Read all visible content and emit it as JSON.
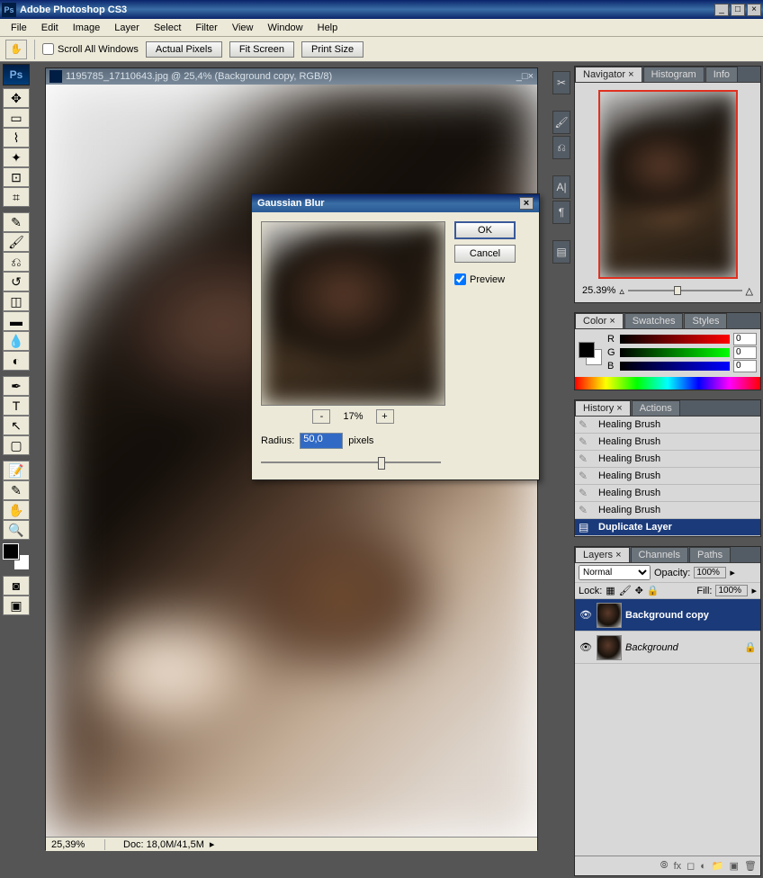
{
  "app": {
    "title": "Adobe Photoshop CS3"
  },
  "menu": [
    "File",
    "Edit",
    "Image",
    "Layer",
    "Select",
    "Filter",
    "View",
    "Window",
    "Help"
  ],
  "optbar": {
    "scroll_all": "Scroll All Windows",
    "actual_pixels": "Actual Pixels",
    "fit_screen": "Fit Screen",
    "print_size": "Print Size"
  },
  "document": {
    "title": "1195785_17110643.jpg @ 25,4% (Background copy, RGB/8)",
    "zoom": "25,39%",
    "docinfo": "Doc: 18,0M/41,5M"
  },
  "dialog": {
    "title": "Gaussian Blur",
    "zoom_pct": "17%",
    "radius_label": "Radius:",
    "radius_value": "50,0",
    "radius_unit": "pixels",
    "ok": "OK",
    "cancel": "Cancel",
    "preview": "Preview"
  },
  "navigator": {
    "tabs": [
      "Navigator",
      "Histogram",
      "Info"
    ],
    "zoom": "25.39%"
  },
  "color": {
    "tabs": [
      "Color",
      "Swatches",
      "Styles"
    ],
    "r": "0",
    "g": "0",
    "b": "0"
  },
  "history": {
    "tabs": [
      "History",
      "Actions"
    ],
    "items": [
      {
        "label": "Healing Brush",
        "active": false
      },
      {
        "label": "Healing Brush",
        "active": false
      },
      {
        "label": "Healing Brush",
        "active": false
      },
      {
        "label": "Healing Brush",
        "active": false
      },
      {
        "label": "Healing Brush",
        "active": false
      },
      {
        "label": "Healing Brush",
        "active": false
      },
      {
        "label": "Duplicate Layer",
        "active": true
      }
    ]
  },
  "layers": {
    "tabs": [
      "Layers",
      "Channels",
      "Paths"
    ],
    "blend": "Normal",
    "opacity_label": "Opacity:",
    "opacity": "100%",
    "lock_label": "Lock:",
    "fill_label": "Fill:",
    "fill": "100%",
    "items": [
      {
        "name": "Background copy",
        "active": true,
        "locked": false
      },
      {
        "name": "Background",
        "active": false,
        "locked": true
      }
    ]
  }
}
